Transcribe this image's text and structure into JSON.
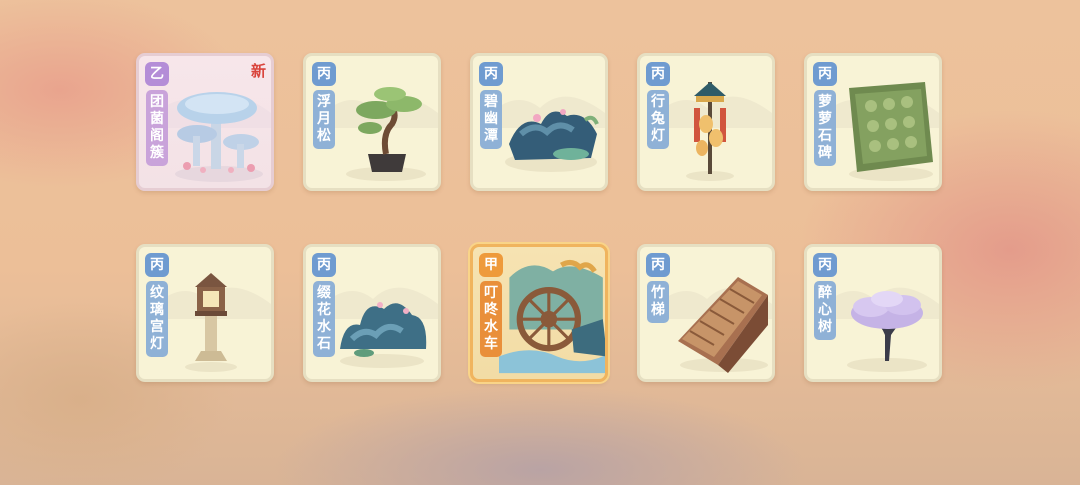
{
  "cards": [
    {
      "grade": "乙",
      "name": [
        "团",
        "菌",
        "阁",
        "簇"
      ],
      "is_new": true,
      "new_label": "新",
      "art": "mushroom-pavilion-icon"
    },
    {
      "grade": "丙",
      "name": [
        "浮",
        "月",
        "松"
      ],
      "is_new": false,
      "art": "bonsai-pine-icon"
    },
    {
      "grade": "丙",
      "name": [
        "碧",
        "幽",
        "潭"
      ],
      "is_new": false,
      "art": "pond-rocks-icon"
    },
    {
      "grade": "丙",
      "name": [
        "行",
        "兔",
        "灯"
      ],
      "is_new": false,
      "art": "rabbit-lantern-icon"
    },
    {
      "grade": "丙",
      "name": [
        "萝",
        "萝",
        "石",
        "碑"
      ],
      "is_new": false,
      "art": "stone-tablet-icon"
    },
    {
      "grade": "丙",
      "name": [
        "纹",
        "璃",
        "宫",
        "灯"
      ],
      "is_new": false,
      "art": "stone-lantern-icon"
    },
    {
      "grade": "丙",
      "name": [
        "缀",
        "花",
        "水",
        "石"
      ],
      "is_new": false,
      "art": "flower-rocks-icon"
    },
    {
      "grade": "甲",
      "name": [
        "叮",
        "咚",
        "水",
        "车"
      ],
      "is_new": false,
      "art": "waterwheel-icon"
    },
    {
      "grade": "丙",
      "name": [
        "竹",
        "梯"
      ],
      "is_new": false,
      "art": "bamboo-ladder-icon"
    },
    {
      "grade": "丙",
      "name": [
        "醉",
        "心",
        "树"
      ],
      "is_new": false,
      "art": "purple-tree-icon"
    }
  ],
  "colors": {
    "grade_jia": "#ee9a3b",
    "grade_yi": "#b48dd7",
    "grade_bing": "#6f9bd0",
    "new_tag": "#d9443c"
  }
}
